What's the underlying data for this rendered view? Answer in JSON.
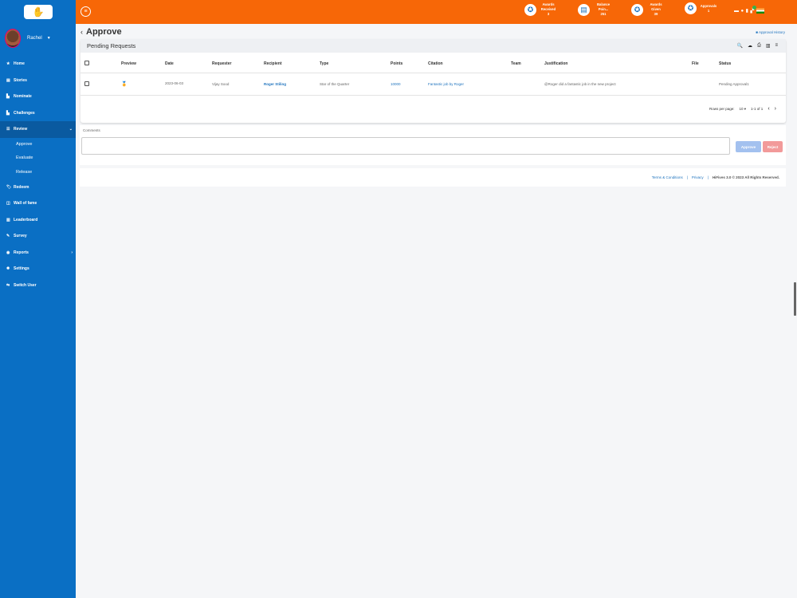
{
  "sidebar": {
    "user_name": "Rachel",
    "items": [
      {
        "icon": "★",
        "label": "Home"
      },
      {
        "icon": "▤",
        "label": "Stories"
      },
      {
        "icon": "▙",
        "label": "Nominate"
      },
      {
        "icon": "▙",
        "label": "Challenges"
      },
      {
        "icon": "☰",
        "label": "Review"
      }
    ],
    "sub_items": [
      "Approve",
      "Evaluate",
      "Release"
    ],
    "items2": [
      {
        "icon": "🏷",
        "label": "Redeem"
      },
      {
        "icon": "◫",
        "label": "Wall of fame"
      },
      {
        "icon": "▥",
        "label": "Leaderboard"
      },
      {
        "icon": "✎",
        "label": "Survey"
      },
      {
        "icon": "◉",
        "label": "Reports"
      },
      {
        "icon": "✹",
        "label": "Settings"
      },
      {
        "icon": "⇆",
        "label": "Switch User"
      }
    ]
  },
  "topbar": {
    "stats": [
      {
        "label": "Awards Received",
        "value": "3"
      },
      {
        "label": "Balance Poin...",
        "value": "251"
      },
      {
        "label": "Awards Given",
        "value": "39"
      },
      {
        "label": "Approvals",
        "value": "1"
      }
    ]
  },
  "page": {
    "title": "Approve",
    "history_link": "Approval History"
  },
  "table": {
    "title": "Pending Requests",
    "columns": [
      "Preview",
      "Date",
      "Requester",
      "Recipient",
      "Type",
      "Points",
      "Citation",
      "Team",
      "Justification",
      "File",
      "Status"
    ],
    "rows": [
      {
        "preview": "🏅",
        "date": "2023-06-03",
        "requester": "Vijay Sood",
        "recipient": "Roger Stiling",
        "type": "Star of the Quarter",
        "points": "10000",
        "citation": "Fantastic job by Roger",
        "team": "",
        "justification": "@Roger did a fantastic job in the new project",
        "file": "",
        "status": "Pending Approval1"
      }
    ],
    "rows_per_page_label": "Rows per page:",
    "rows_per_page_value": "10",
    "range": "1-1 of 1"
  },
  "comments": {
    "label": "Comments",
    "approve_label": "Approve",
    "reject_label": "Reject"
  },
  "footer": {
    "terms": "Terms & Conditions",
    "sep": "|",
    "privacy": "Privacy",
    "copyright": "HiFives 3.0 © 2023 All Rights Reserved."
  },
  "colors": {
    "sidebar": "#0a6fc4",
    "topbar": "#f76707",
    "accent": "#1e73be"
  }
}
